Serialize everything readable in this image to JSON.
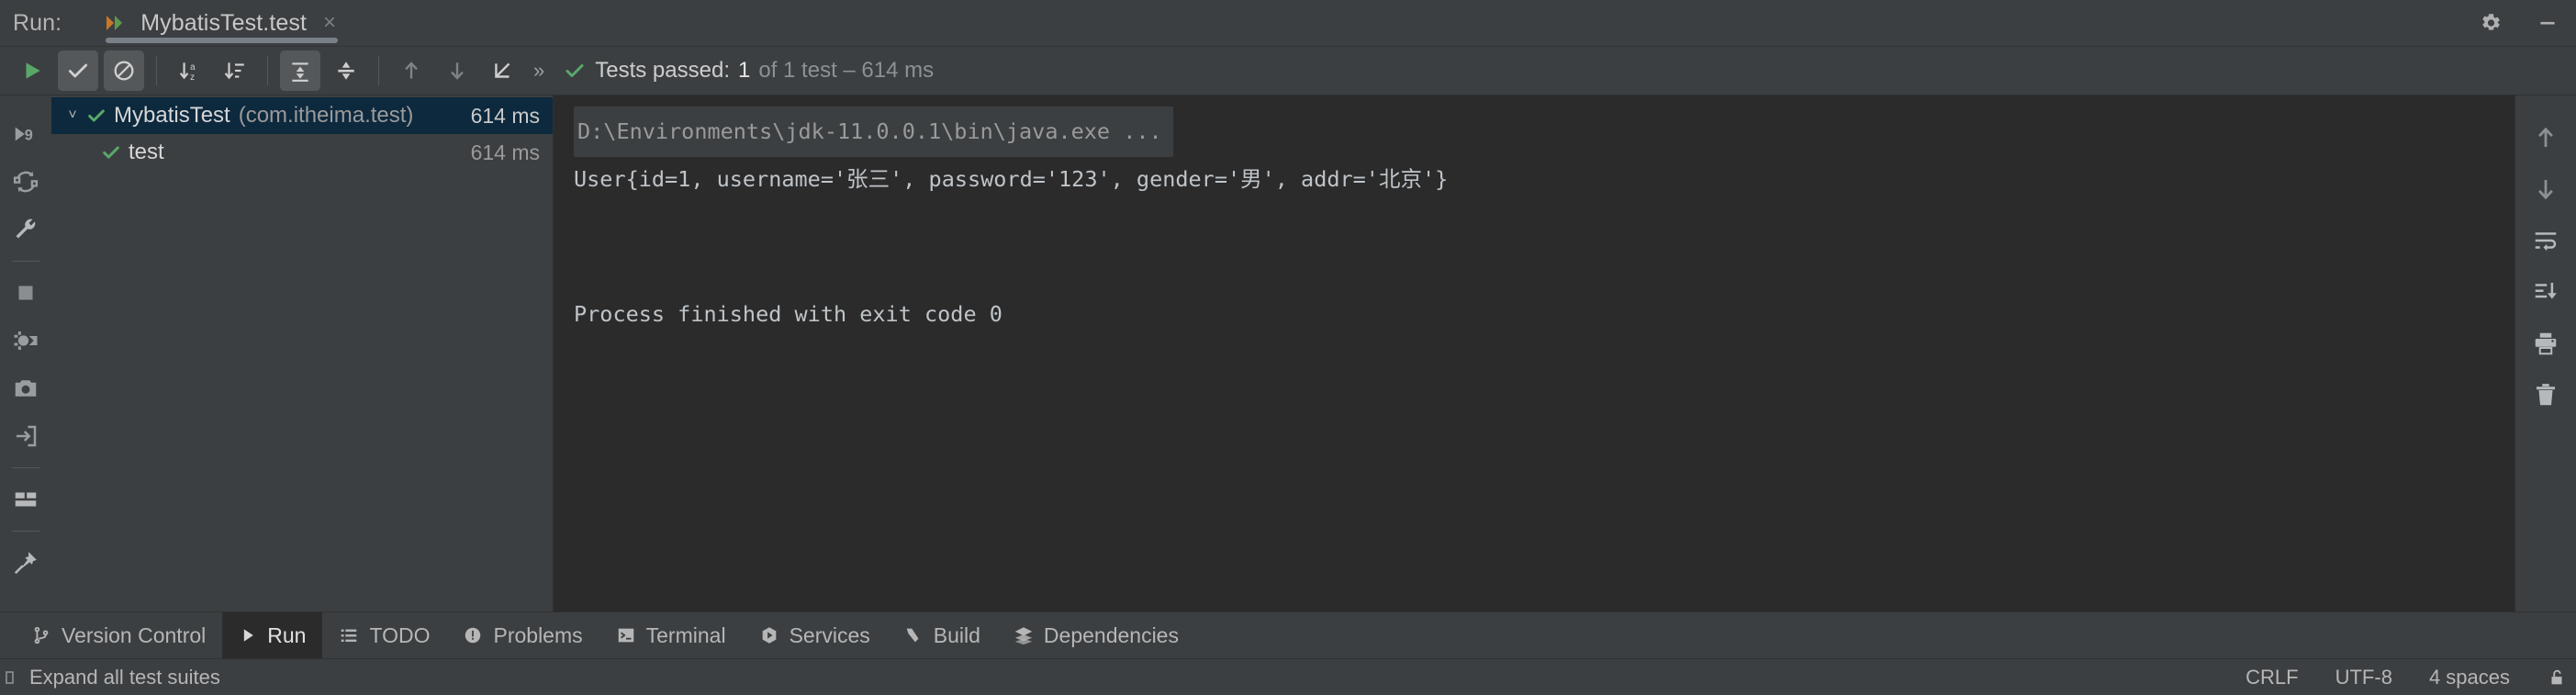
{
  "window": {
    "run_label": "Run:",
    "tab_title": "MybatisTest.test",
    "close_glyph": "×",
    "settings_icon": "gear-icon",
    "minimize_icon": "minimize-icon"
  },
  "toolbar": {
    "buttons": [
      {
        "name": "rerun-tests-button",
        "icon": "play-icon",
        "toggled": false
      },
      {
        "name": "show-passed-button",
        "icon": "checkmark-icon",
        "toggled": true
      },
      {
        "name": "show-ignored-button",
        "icon": "no-entry-icon",
        "toggled": true
      },
      {
        "name": "sort-alphabetically-button",
        "icon": "sort-alpha-icon",
        "toggled": false
      },
      {
        "name": "sort-by-duration-button",
        "icon": "sort-duration-icon",
        "toggled": false
      },
      {
        "name": "expand-all-button",
        "icon": "expand-all-icon",
        "toggled": true
      },
      {
        "name": "collapse-all-button",
        "icon": "collapse-all-icon",
        "toggled": false
      },
      {
        "name": "previous-failed-button",
        "icon": "arrow-up-icon",
        "toggled": false
      },
      {
        "name": "next-failed-button",
        "icon": "arrow-down-icon",
        "toggled": false
      },
      {
        "name": "scroll-to-source-button",
        "icon": "scroll-to-source-icon",
        "toggled": false
      }
    ],
    "overflow_glyph": "»",
    "status": {
      "icon": "green-check-icon",
      "label": "Tests passed:",
      "count": "1",
      "rest": "of 1 test – 614 ms"
    }
  },
  "left_rail": [
    {
      "name": "rerun-icon",
      "glyph": "rerun-9"
    },
    {
      "name": "rerun-failed-icon",
      "glyph": "rerun-auto"
    },
    {
      "name": "settings-wrench-icon",
      "glyph": "wrench"
    },
    {
      "name": "stop-icon",
      "glyph": "stop-square"
    },
    {
      "name": "debug-icon",
      "glyph": "bug"
    },
    {
      "name": "screenshot-icon",
      "glyph": "camera"
    },
    {
      "name": "export-icon",
      "glyph": "export-arrow"
    },
    {
      "name": "layout-icon",
      "glyph": "layout"
    },
    {
      "name": "pin-tab-icon",
      "glyph": "pin"
    }
  ],
  "tree": {
    "rows": [
      {
        "name": "MybatisTest",
        "package": "(com.itheima.test)",
        "time": "614 ms",
        "selected": true,
        "expanded": true,
        "twisty": "˅",
        "status_icon": "green-check-icon",
        "indented": false
      },
      {
        "name": "test",
        "package": "",
        "time": "614 ms",
        "selected": false,
        "expanded": false,
        "twisty": "",
        "status_icon": "green-check-icon",
        "indented": true
      }
    ]
  },
  "console": {
    "command_line": "D:\\Environments\\jdk-11.0.0.1\\bin\\java.exe ...",
    "lines": [
      "User{id=1, username='张三', password='123', gender='男', addr='北京'}",
      "",
      "",
      "Process finished with exit code 0"
    ]
  },
  "console_rail": [
    {
      "name": "scroll-up-icon",
      "glyph": "arrow-up"
    },
    {
      "name": "scroll-down-icon",
      "glyph": "arrow-down"
    },
    {
      "name": "soft-wrap-icon",
      "glyph": "soft-wrap"
    },
    {
      "name": "scroll-to-end-icon",
      "glyph": "scroll-end"
    },
    {
      "name": "print-icon",
      "glyph": "printer"
    },
    {
      "name": "clear-all-icon",
      "glyph": "trash"
    }
  ],
  "bottom_tabs": [
    {
      "label": "Version Control",
      "icon": "branch-icon",
      "active": false
    },
    {
      "label": "Run",
      "icon": "play-icon",
      "active": true
    },
    {
      "label": "TODO",
      "icon": "list-icon",
      "active": false
    },
    {
      "label": "Problems",
      "icon": "exclamation-circle-icon",
      "active": false
    },
    {
      "label": "Terminal",
      "icon": "terminal-icon",
      "active": false
    },
    {
      "label": "Services",
      "icon": "services-icon",
      "active": false
    },
    {
      "label": "Build",
      "icon": "hammer-icon",
      "active": false
    },
    {
      "label": "Dependencies",
      "icon": "layers-icon",
      "active": false
    }
  ],
  "statusbar": {
    "hint": "Expand all test suites",
    "line_separator": "CRLF",
    "encoding": "UTF-8",
    "indent": "4 spaces",
    "lock_icon": "unlocked-icon"
  },
  "colors": {
    "panel_bg": "#3c3f41",
    "console_bg": "#2b2b2b",
    "selection_bg": "#0d293e",
    "success_green": "#59a869",
    "tab_accent_orange": "#c87629",
    "text_primary": "#bbbbbb",
    "text_dim": "#8d9094"
  }
}
